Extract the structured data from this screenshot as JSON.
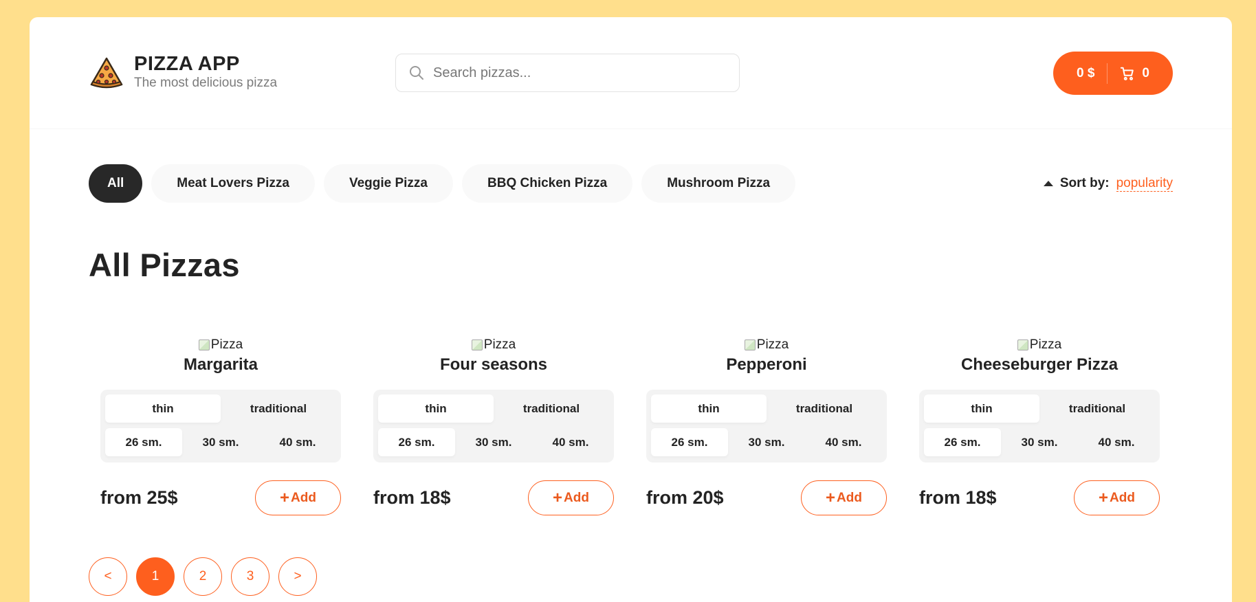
{
  "header": {
    "logo_title": "PIZZA APP",
    "logo_subtitle": "The most delicious pizza",
    "search_placeholder": "Search pizzas...",
    "cart_total": "0 $",
    "cart_count": "0"
  },
  "categories": [
    "All",
    "Meat Lovers Pizza",
    "Veggie Pizza",
    "BBQ Chicken Pizza",
    "Mushroom Pizza"
  ],
  "active_category": "All",
  "sort": {
    "label": "Sort by:",
    "value": "popularity"
  },
  "page_title": "All Pizzas",
  "pizzas": [
    {
      "img_alt": "Pizza",
      "title": "Margarita",
      "types": [
        "thin",
        "traditional"
      ],
      "sizes": [
        "26 sm.",
        "30 sm.",
        "40 sm."
      ],
      "price": "from 25$",
      "add_label": "Add"
    },
    {
      "img_alt": "Pizza",
      "title": "Four seasons",
      "types": [
        "thin",
        "traditional"
      ],
      "sizes": [
        "26 sm.",
        "30 sm.",
        "40 sm."
      ],
      "price": "from 18$",
      "add_label": "Add"
    },
    {
      "img_alt": "Pizza",
      "title": "Pepperoni",
      "types": [
        "thin",
        "traditional"
      ],
      "sizes": [
        "26 sm.",
        "30 sm.",
        "40 sm."
      ],
      "price": "from 20$",
      "add_label": "Add"
    },
    {
      "img_alt": "Pizza",
      "title": "Cheeseburger Pizza",
      "types": [
        "thin",
        "traditional"
      ],
      "sizes": [
        "26 sm.",
        "30 sm.",
        "40 sm."
      ],
      "price": "from 18$",
      "add_label": "Add"
    }
  ],
  "pagination": {
    "prev": "<",
    "pages": [
      "1",
      "2",
      "3"
    ],
    "active": "1",
    "next": ">"
  },
  "colors": {
    "accent": "#fe5f1e",
    "background": "#ffdf8c",
    "dark": "#282828"
  }
}
